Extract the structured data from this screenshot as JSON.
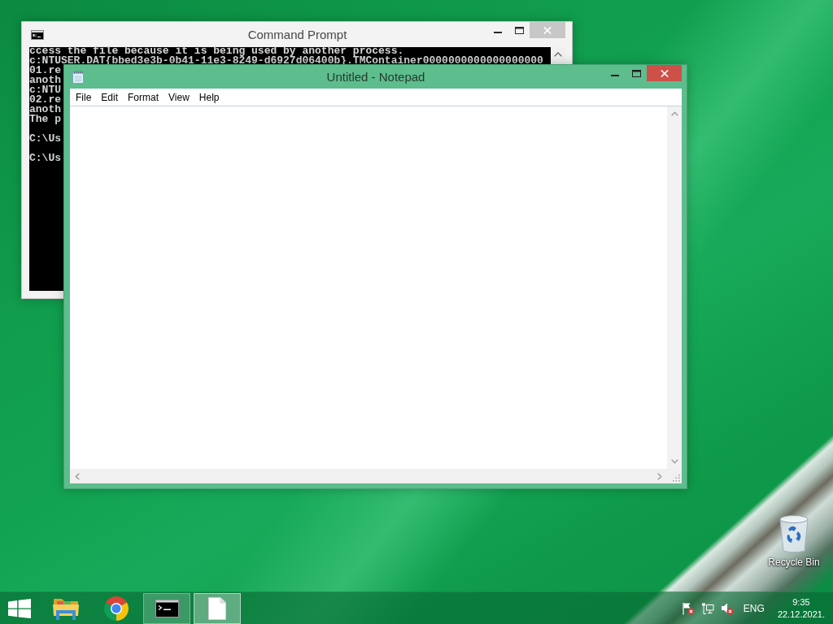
{
  "windows": [
    {
      "kind": "console",
      "title": "Command Prompt",
      "active": false,
      "output": [
        [
          "ccess the file because it is being used by another process.",
          "c:NTUSER.DAT{bbed3e3b-0b41-11e3-8249-d6927d06400b}.TMContainer0000000000000000000",
          "01.re",
          "anoth",
          "c:NTU",
          "02.re",
          "anoth",
          "The p"
        ],
        [
          "C:\\Us"
        ],
        [
          "C:\\Us"
        ]
      ]
    },
    {
      "kind": "editor",
      "title": "Untitled - Notepad",
      "active": true,
      "menu": [
        "File",
        "Edit",
        "Format",
        "View",
        "Help"
      ]
    }
  ],
  "desktop_icons": [
    {
      "label": "Recycle Bin"
    }
  ],
  "taskbar": {
    "apps": [
      {
        "kind": "folder",
        "running": false,
        "selected": false
      },
      {
        "kind": "browser",
        "running": false,
        "selected": false
      },
      {
        "kind": "console",
        "running": true,
        "selected": false
      },
      {
        "kind": "notepad",
        "running": true,
        "selected": true
      }
    ],
    "tray": {
      "language": "ENG",
      "time": "9:35",
      "date": "22.12.2021."
    }
  }
}
